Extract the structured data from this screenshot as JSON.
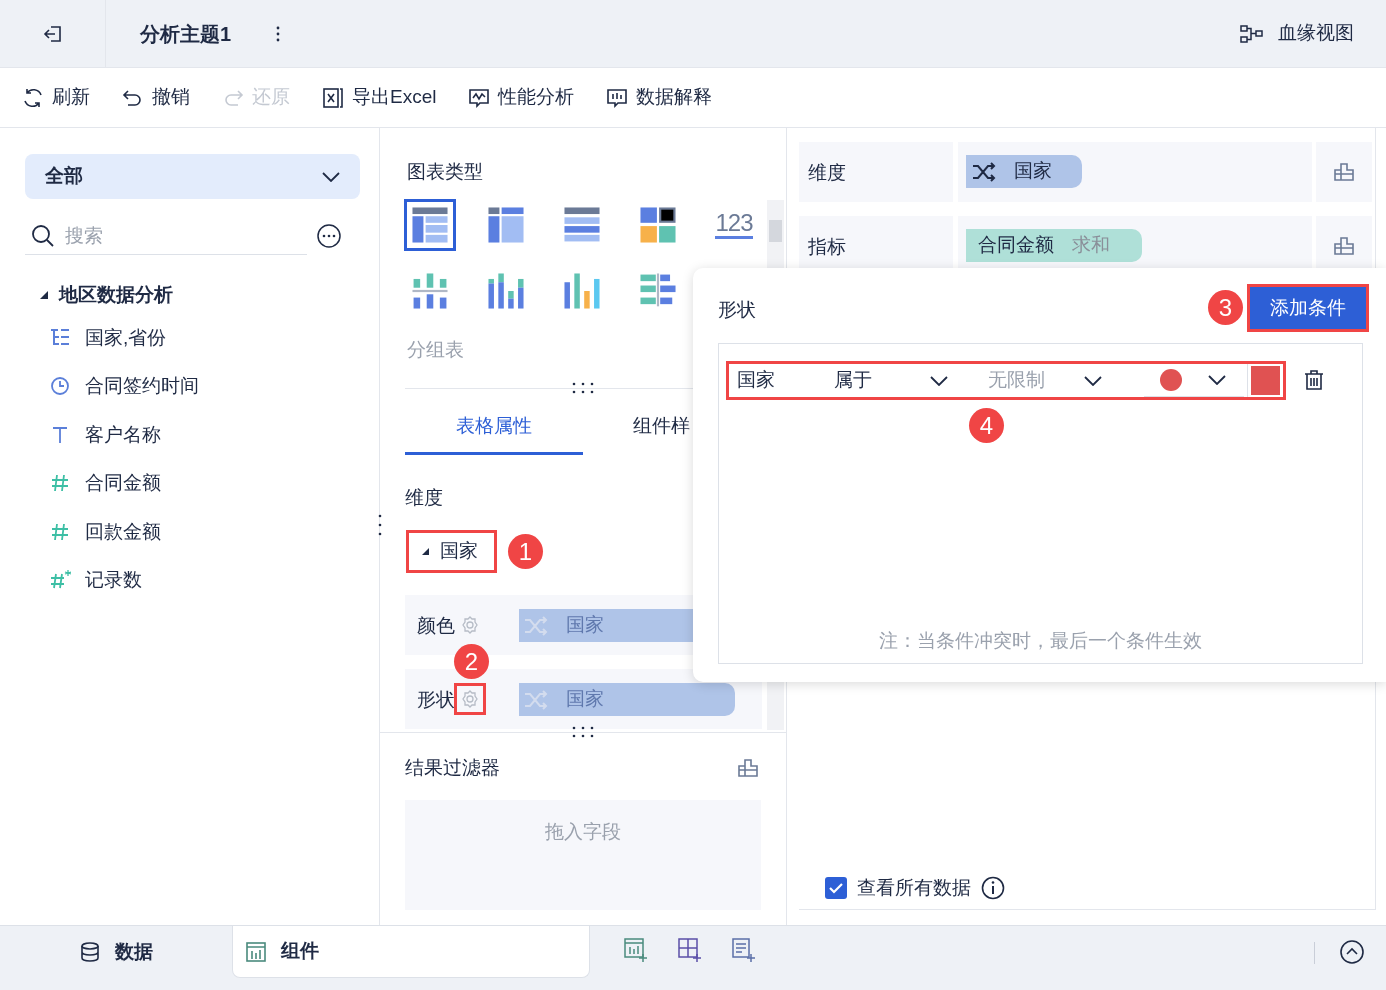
{
  "header": {
    "title": "分析主题1",
    "lineage_view": "血缘视图"
  },
  "toolbar": [
    {
      "kind": "refresh",
      "label": "刷新",
      "disabled": false
    },
    {
      "kind": "undo",
      "label": "撤销",
      "disabled": false
    },
    {
      "kind": "redo",
      "label": "还原",
      "disabled": true
    },
    {
      "kind": "excel",
      "label": "导出Excel",
      "disabled": false
    },
    {
      "kind": "performance",
      "label": "性能分析",
      "disabled": false
    },
    {
      "kind": "explain",
      "label": "数据解释",
      "disabled": false
    }
  ],
  "data_panel": {
    "scope": "全部",
    "search": {
      "placeholder": "搜索"
    },
    "tree": {
      "label": "地区数据分析",
      "expanded": true,
      "children": [
        {
          "kind": "hierarchy",
          "label": "国家,省份"
        },
        {
          "kind": "time",
          "label": "合同签约时间"
        },
        {
          "kind": "text",
          "label": "客户名称"
        },
        {
          "kind": "number",
          "label": "合同金额"
        },
        {
          "kind": "number",
          "label": "回款金额"
        },
        {
          "kind": "count",
          "label": "记录数"
        }
      ]
    }
  },
  "chart_panel": {
    "title": "图表类型",
    "chart_types": [
      {
        "kind": "grouped-table",
        "selected": true
      },
      {
        "kind": "crosstab",
        "selected": false
      },
      {
        "kind": "detail-table",
        "selected": false
      },
      {
        "kind": "dashboard",
        "selected": false
      },
      {
        "kind": "kpi",
        "text": "123",
        "selected": false
      },
      {
        "kind": "diverging",
        "selected": false
      },
      {
        "kind": "stacked",
        "selected": false
      },
      {
        "kind": "column",
        "selected": false
      },
      {
        "kind": "bar-table",
        "selected": false
      }
    ],
    "chart_name": "分组表",
    "tabs": [
      {
        "label": "表格属性",
        "selected": true
      },
      {
        "label": "组件样",
        "selected": false
      }
    ],
    "dimension_title": "维度",
    "dimension_field": {
      "label": "国家",
      "expanded": true
    },
    "properties": [
      {
        "label": "颜色",
        "field": "国家"
      },
      {
        "label": "形状",
        "field": "国家"
      }
    ],
    "result_filter": {
      "title": "结果过滤器",
      "placeholder": "拖入字段"
    }
  },
  "field_panel": {
    "rows": [
      {
        "kind": "dimension",
        "label": "维度",
        "field": "国家"
      },
      {
        "kind": "measure",
        "label": "指标",
        "field": "合同金额",
        "aggregation": "求和"
      }
    ],
    "view_all": {
      "label": "查看所有数据",
      "checked": true
    }
  },
  "shape_dialog": {
    "title": "形状",
    "add_button": "添加条件",
    "conditions": [
      {
        "field": "国家",
        "operator": "属于",
        "value": "无限制",
        "color": "#e05252"
      }
    ],
    "note": "注：当条件冲突时，最后一个条件生效"
  },
  "annotations": [
    "1",
    "2",
    "3",
    "4"
  ],
  "bottom_tabs": [
    {
      "kind": "data",
      "label": "数据",
      "selected": false
    },
    {
      "kind": "component",
      "label": "组件",
      "selected": true
    }
  ]
}
